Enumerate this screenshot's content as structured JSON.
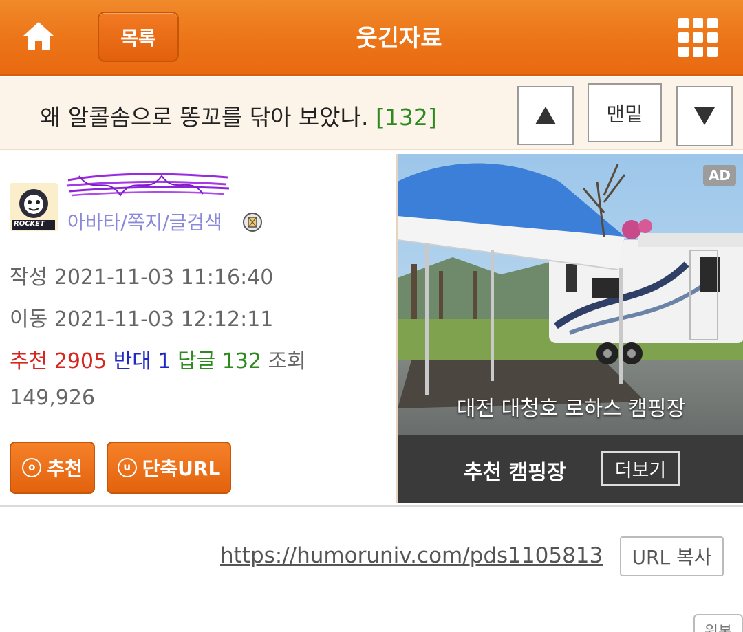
{
  "header": {
    "list_label": "목록",
    "title": "웃긴자료",
    "home_icon": "home-icon",
    "menu_icon": "grid-menu-icon"
  },
  "post": {
    "title": "왜 알콜솜으로 똥꼬를 닦아 보았나.",
    "reply_count": "[132]",
    "nav": {
      "up_icon": "▲",
      "bottom_label": "맨밑",
      "down_icon": "▼"
    }
  },
  "author": {
    "avatar_text": "ROCKET",
    "member_links": "아바타/쪽지/글검색"
  },
  "info": {
    "written_label": "작성",
    "written": "2021-11-03 11:16:40",
    "moved_label": "이동",
    "moved": "2021-11-03 12:12:11",
    "recommend_label": "추천",
    "recommend_count": "2905",
    "oppose_label": "반대",
    "oppose_count": "1",
    "reply_label": "답글",
    "reply_count": "132",
    "views_label": "조회",
    "views_count": "149,926"
  },
  "actions": {
    "recommend_label": "추천",
    "recommend_icon": "ⓞ",
    "shorturl_label": "단축URL",
    "shorturl_icon": "ⓤ"
  },
  "ad": {
    "badge": "AD",
    "place_name": "대전 대청호 로하스 캠핑장",
    "footer_title": "추천 캠핑장",
    "more_label": "더보기"
  },
  "url": {
    "link": "https://humoruniv.com/pds1105813",
    "copy_label": "URL 복사",
    "original_label": "원본"
  },
  "colors": {
    "header_orange": "#ec7418",
    "recommend_red": "#d6261f",
    "oppose_blue": "#1f28c4",
    "reply_green": "#2d8a1d",
    "member_link_purple": "#8a88d8"
  }
}
